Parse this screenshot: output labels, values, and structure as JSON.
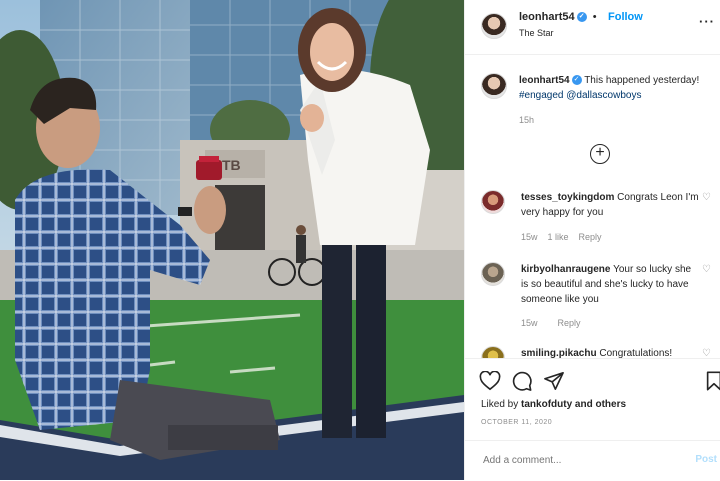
{
  "header": {
    "username": "leonhart54",
    "follow_label": "Follow",
    "separator": "•",
    "subtitle": "The Star",
    "more_label": "···"
  },
  "caption": {
    "username": "leonhart54",
    "text": "This happened yesterday!",
    "hashtag": "#engaged",
    "mention": "@dallascowboys",
    "time": "15h"
  },
  "comments": [
    {
      "username": "tesses_toykingdom",
      "text": "Congrats Leon I'm very happy for you",
      "time": "15w",
      "likes": "1 like",
      "reply": "Reply"
    },
    {
      "username": "kirbyolhanraugene",
      "text": "Your so lucky she is so beautiful and she's lucky to have someone like you",
      "time": "15w",
      "likes": "",
      "reply": "Reply"
    },
    {
      "username": "smiling.pikachu",
      "text": "Congratulations!",
      "time": "",
      "likes": "",
      "reply": ""
    }
  ],
  "actions": {
    "liked_by_prefix": "Liked by",
    "liked_by_user": "tankofduty",
    "liked_by_suffix": "and others",
    "date": "OCTOBER 11, 2020"
  },
  "add_comment": {
    "placeholder": "Add a comment...",
    "post_label": "Post"
  },
  "photo": {
    "building_sign": "TB"
  },
  "colors": {
    "accent": "#0095f6",
    "verified": "#3897f0",
    "link": "#00376b",
    "muted": "#8e8e8e"
  },
  "icons": [
    "verified-badge-icon",
    "more-options-icon",
    "load-more-icon",
    "heart-icon",
    "comment-icon",
    "share-icon",
    "bookmark-icon"
  ]
}
